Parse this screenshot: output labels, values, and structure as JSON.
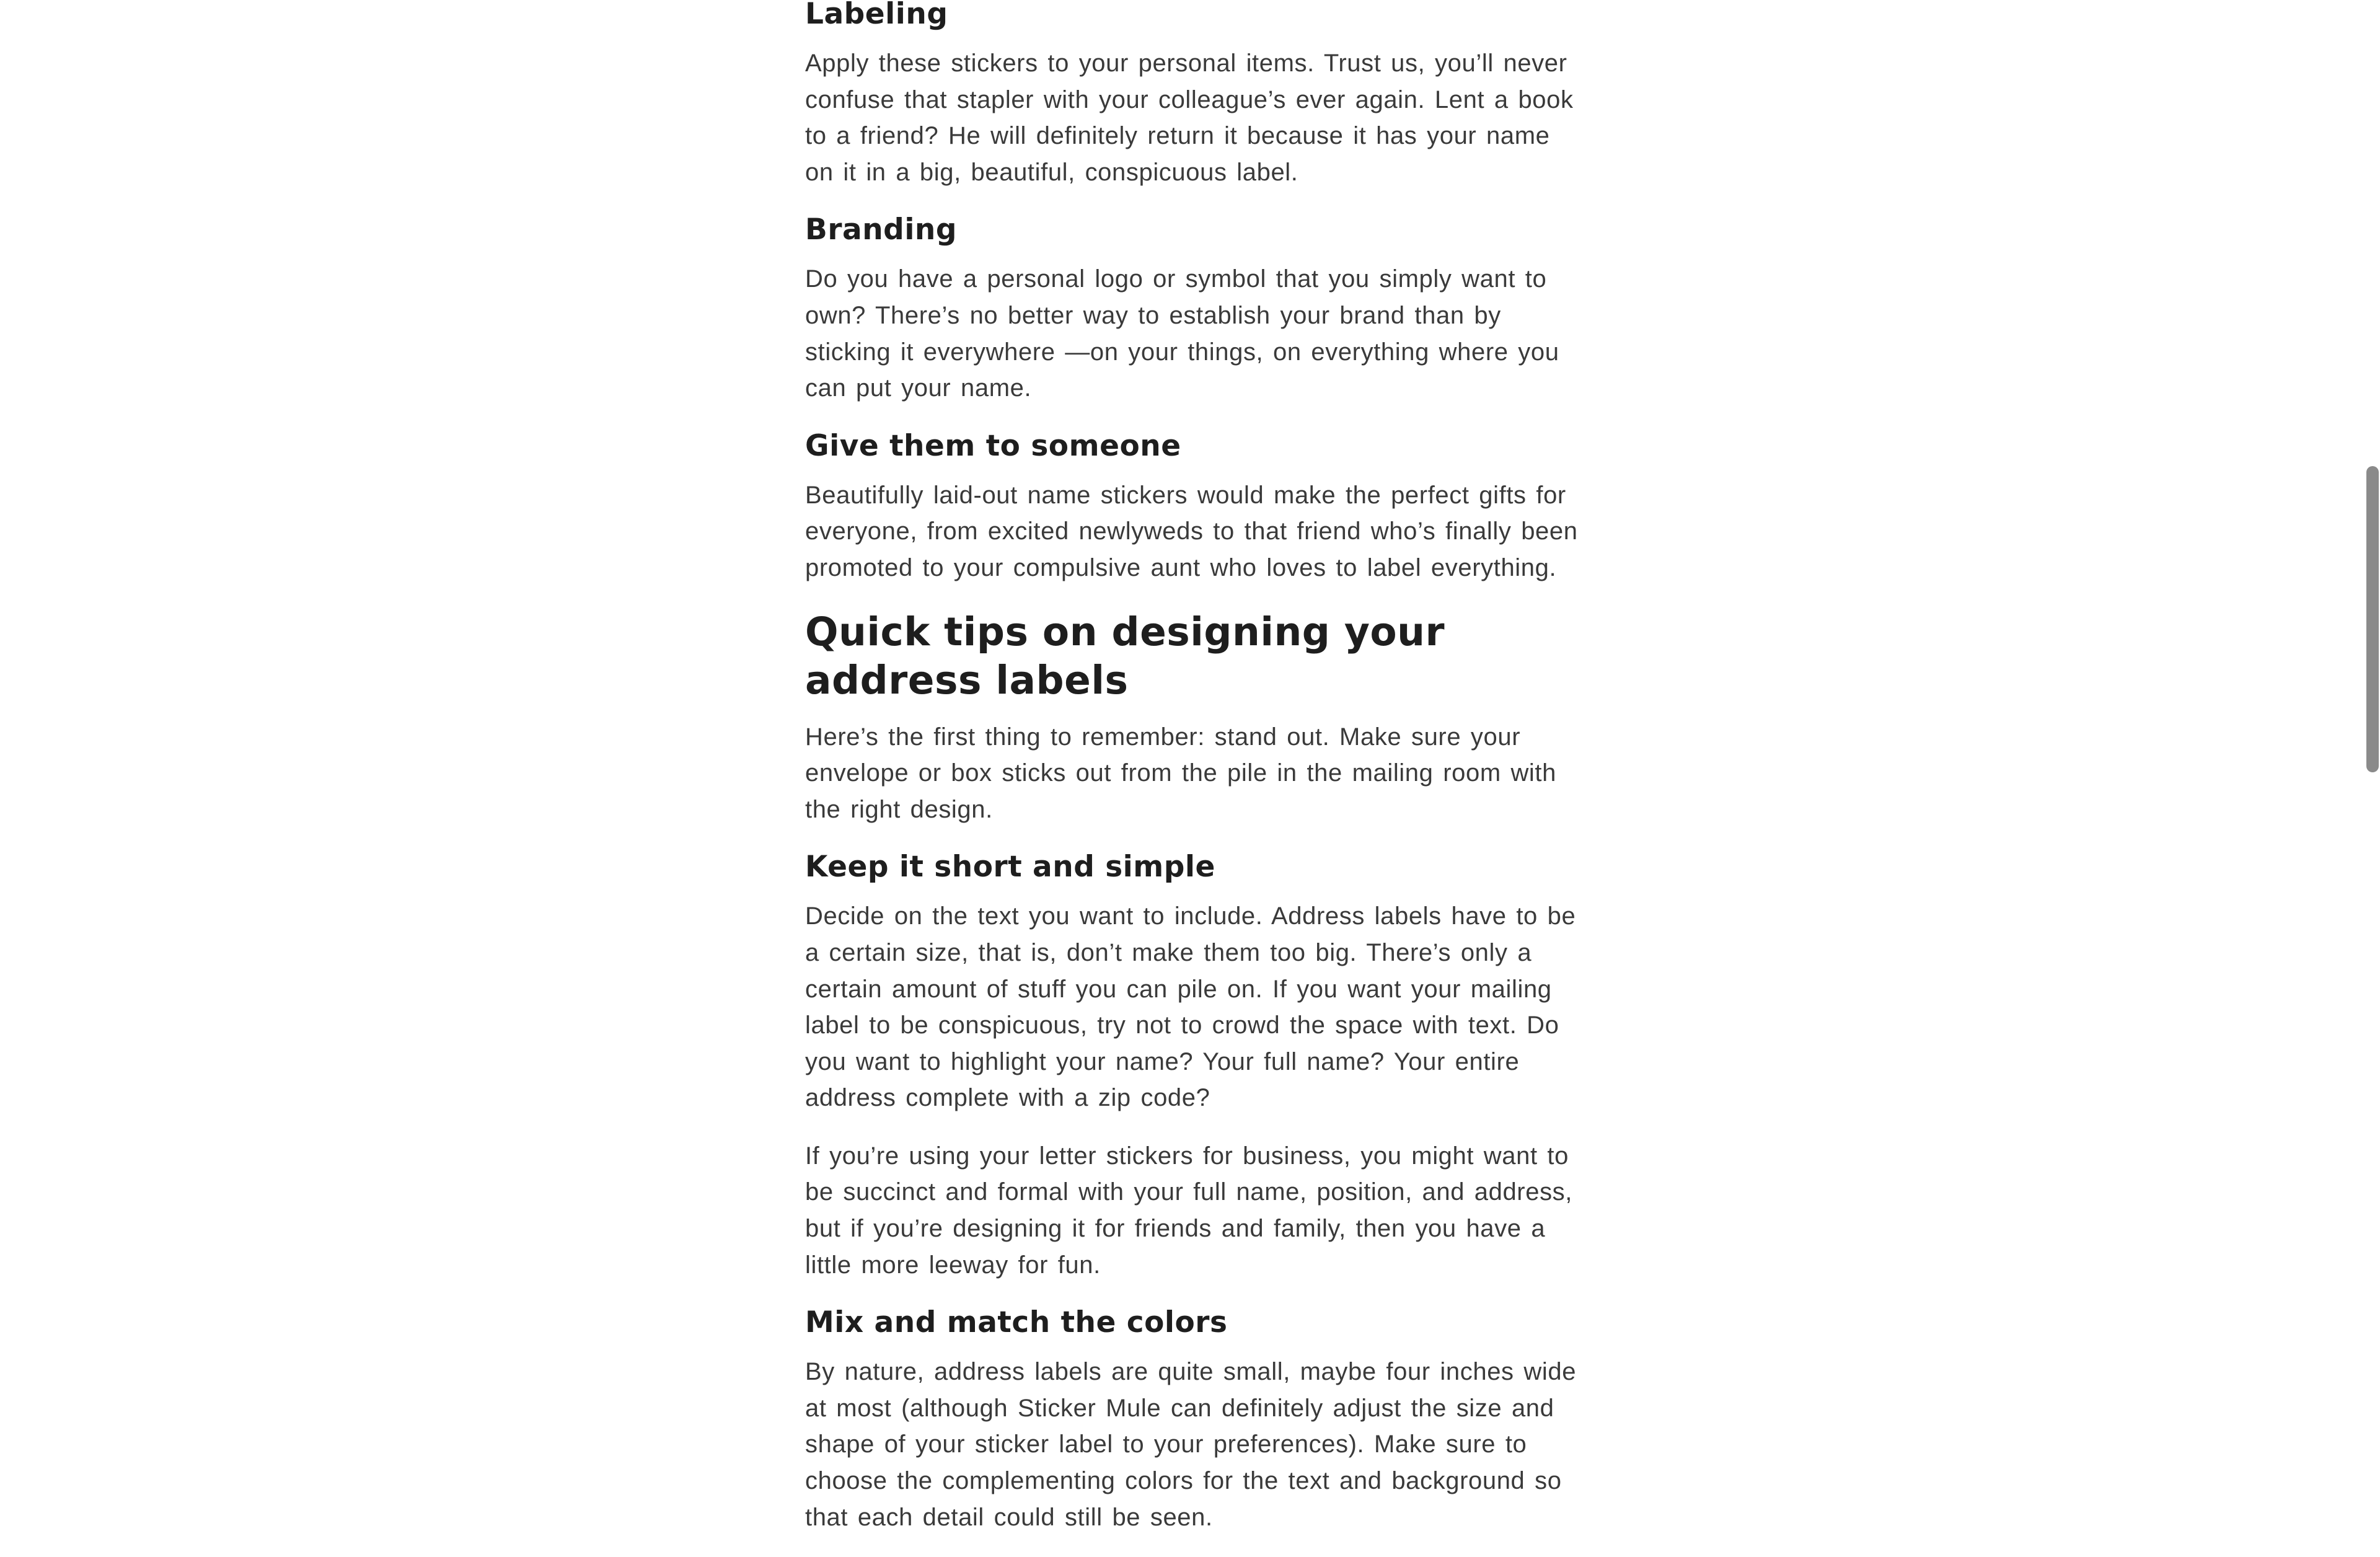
{
  "article": {
    "labeling": {
      "heading": "Labeling",
      "body": "Apply these stickers to your personal items. Trust us, you’ll never confuse that stapler with your colleague’s ever again. Lent a book to a friend? He will definitely return it because it has your name on it in a big, beautiful, conspicuous label."
    },
    "branding": {
      "heading": "Branding",
      "body": "Do you have a personal logo or symbol that you simply want to own? There’s no better way to establish your brand than by sticking it everywhere —on your things, on everything where you can put your name."
    },
    "give": {
      "heading": "Give them to someone",
      "body": "Beautifully laid-out name stickers would make the perfect gifts for everyone, from excited newlyweds to that friend who’s finally been promoted to your compulsive aunt who loves to label everything."
    },
    "quick_tips": {
      "heading": "Quick tips on designing your address labels",
      "body": "Here’s the first thing to remember: stand out. Make sure your envelope or box sticks out from the pile in the mailing room with the right design."
    },
    "keep_short": {
      "heading": "Keep it short and simple",
      "body1": "Decide on the text you want to include. Address labels have to be a certain size, that is, don’t make them too big. There’s only a certain amount of stuff you can pile on. If you want your mailing label to be conspicuous, try not to crowd the space with text. Do you want to highlight your name? Your full name? Your entire address complete with a zip code?",
      "body2": "If you’re using your letter stickers for business, you might want to be succinct and formal with your full name, position, and address, but if you’re designing it for friends and family, then you have a little more leeway for fun."
    },
    "mix_match": {
      "heading": "Mix and match the colors",
      "body": "By nature, address labels are quite small, maybe four inches wide at most (although Sticker Mule can definitely adjust the size and shape of your sticker label to your preferences). Make sure to choose the complementing colors for the text and background so that each detail could still be seen."
    }
  },
  "colors": {
    "heading_text": "#1e1e1e",
    "body_text": "#3a3a3a",
    "background": "#ffffff",
    "scrollbar_thumb": "#8a8a8a"
  }
}
